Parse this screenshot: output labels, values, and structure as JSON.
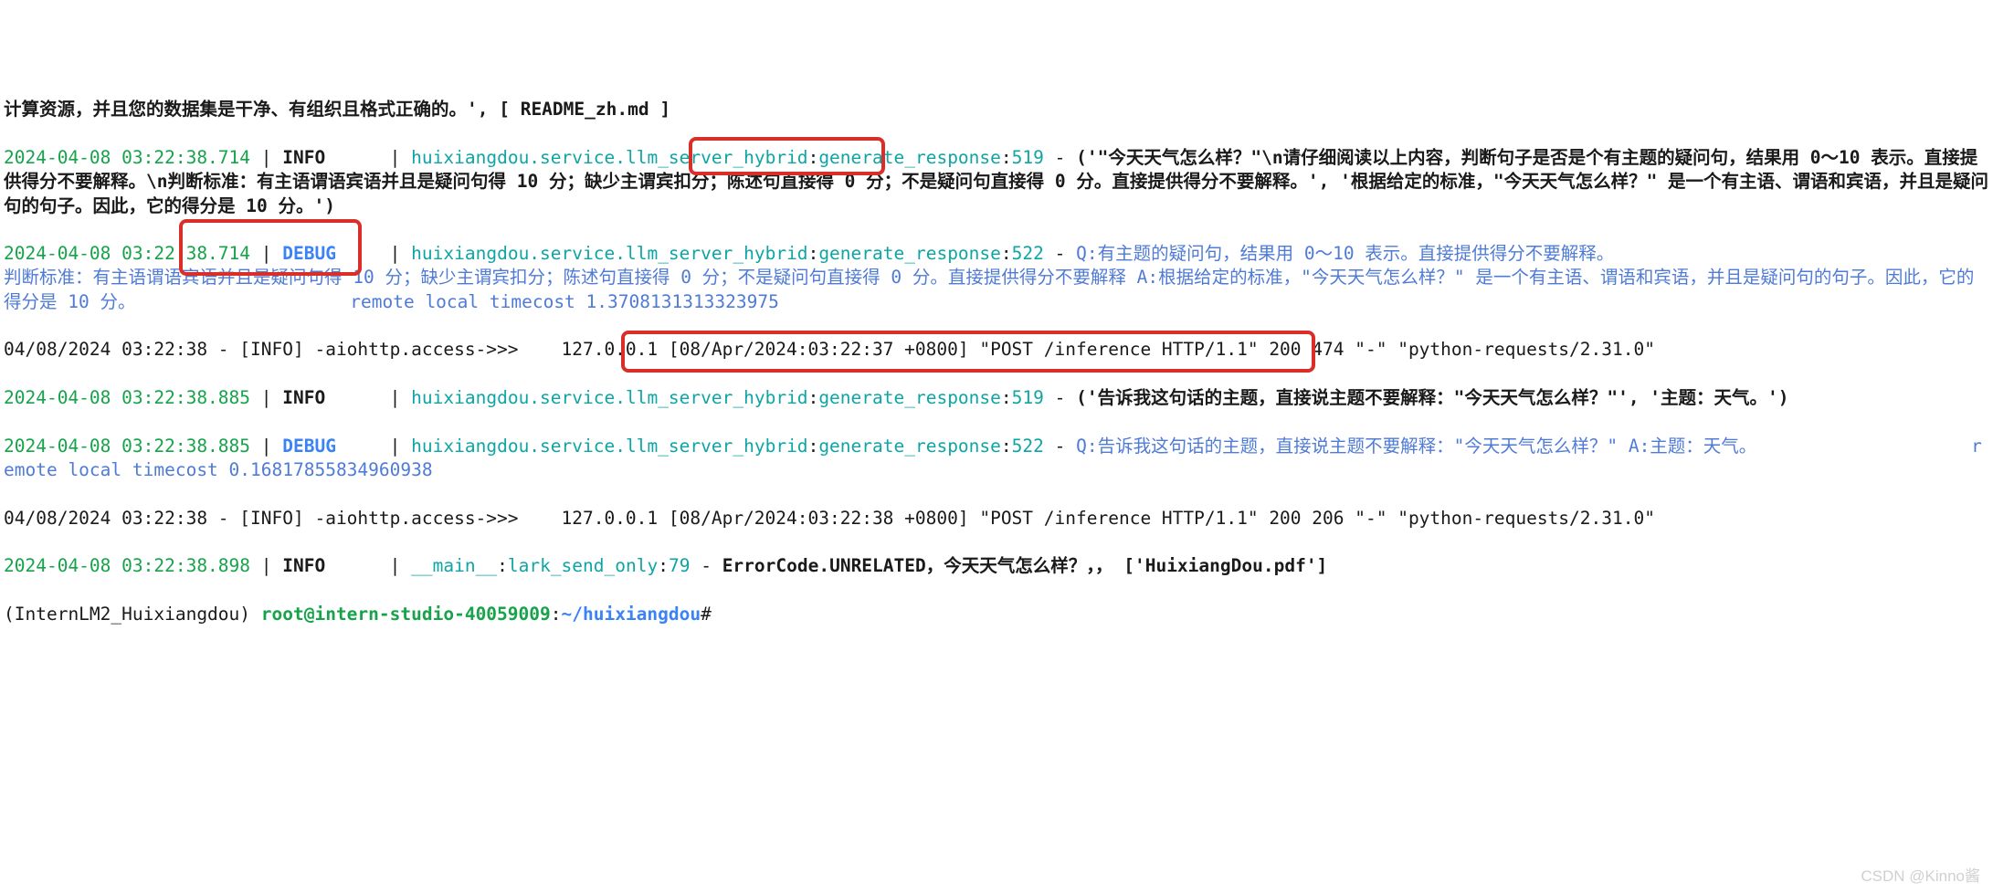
{
  "lines": {
    "l0": "计算资源，并且您的数据集是干净、有组织且格式正确的。', [ README_zh.md ]",
    "l1_ts": "2024-04-08 03:22:38.714",
    "l1_level": "INFO",
    "l1_mod": "huixiangdou.service.llm_server_hybrid",
    "l1_fn": "generate_response",
    "l1_ln": "519",
    "l1_msg": "('\"今天天气怎么样？\"\\n请仔细阅读以上内容，判断句子是否是个有主题的疑问句，结果用 0～10 表示。直接提供得分不要解释。\\n判断标准：有主语谓语宾语并且是疑问句得 10 分；缺少主谓宾扣分；陈述句直接得 0 分；不是疑问句直接得 0 分。直接提供得分不要解释。', '根据给定的标准，\"今天天气怎么样？\" 是一个有主语、谓语和宾语，并且是疑问句的句子。因此，它的得分是 10 分。')",
    "l2_ts": "2024-04-08 03:22:38.714",
    "l2_level": "DEBUG",
    "l2_mod": "huixiangdou.service.llm_server_hybrid",
    "l2_fn": "generate_response",
    "l2_ln": "522",
    "l2_q": "Q:有主题的疑问句，结果用 0～10 表示。直接提供得分不要解释。\n判断标准：有主语谓语宾语并且是疑问句得 10 分；缺少主谓宾扣分；陈述句直接得 0 分；不是疑问句直接得 0 分。直接提供得分不要解释 A:根据给定的标准，\"今天天气怎么样？\" 是一个有主语、谓语和宾语，并且是疑问句的句子。因此，它的得分是 10 分。                    remote local timecost 1.3708131313323975",
    "l3": "04/08/2024 03:22:38 - [INFO] -aiohttp.access->>>    127.0.0.1 [08/Apr/2024:03:22:37 +0800] \"POST /inference HTTP/1.1\" 200 474 \"-\" \"python-requests/2.31.0\"",
    "l4_ts": "2024-04-08 03:22:38.885",
    "l4_level": "INFO",
    "l4_mod": "huixiangdou.service.llm_server_hybrid",
    "l4_fn": "generate_response",
    "l4_ln": "519",
    "l4_msg": "('告诉我这句话的主题，直接说主题不要解释：\"今天天气怎么样？\"', '主题：天气。')",
    "l5_ts": "2024-04-08 03:22:38.885",
    "l5_level": "DEBUG",
    "l5_mod": "huixiangdou.service.llm_server_hybrid",
    "l5_fn": "generate_response",
    "l5_ln": "522",
    "l5_q": "Q:告诉我这句话的主题，直接说主题不要解释：\"今天天气怎么样？\" A:主题：天气。                    remote local timecost 0.16817855834960938",
    "l6": "04/08/2024 03:22:38 - [INFO] -aiohttp.access->>>    127.0.0.1 [08/Apr/2024:03:22:38 +0800] \"POST /inference HTTP/1.1\" 200 206 \"-\" \"python-requests/2.31.0\"",
    "l7_ts": "2024-04-08 03:22:38.898",
    "l7_level": "INFO",
    "l7_mod": "__main__",
    "l7_fn": "lark_send_only",
    "l7_ln": "79",
    "l7_msg": "ErrorCode.UNRELATED，今天天气怎么样？，， ['HuixiangDou.pdf']",
    "prompt_env": "(InternLM2_Huixiangdou) ",
    "prompt_user": "root@intern-studio-40059009",
    "prompt_sep": ":",
    "prompt_path": "~/huixiangdou",
    "prompt_end": "#"
  },
  "sep": {
    "pipe": " | ",
    "colon": ":",
    "dash": " - "
  },
  "watermark": "CSDN @Kinno酱"
}
